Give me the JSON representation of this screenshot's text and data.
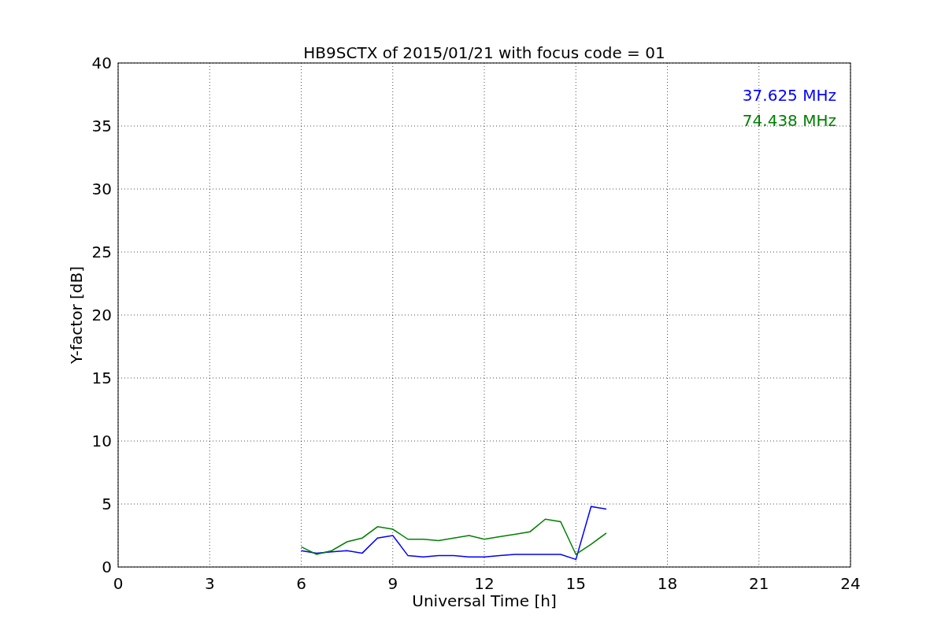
{
  "chart_data": {
    "type": "line",
    "title": "HB9SCTX of 2015/01/21 with focus code = 01",
    "xlabel": "Universal Time [h]",
    "ylabel": "Y-factor [dB]",
    "x": [
      6,
      6.5,
      7,
      7.5,
      8,
      8.5,
      9,
      9.5,
      10,
      10.5,
      11,
      11.5,
      12,
      12.5,
      13,
      13.5,
      14,
      14.5,
      15,
      15.5,
      16
    ],
    "series": [
      {
        "name": "37.625 MHz",
        "color": "#0000ff",
        "values": [
          1.3,
          1.1,
          1.2,
          1.3,
          1.1,
          2.3,
          2.5,
          0.9,
          0.8,
          0.9,
          0.9,
          0.8,
          0.8,
          0.9,
          1.0,
          1.0,
          1.0,
          1.0,
          0.6,
          4.8,
          4.6
        ]
      },
      {
        "name": "74.438 MHz",
        "color": "#008000",
        "values": [
          1.6,
          1.0,
          1.3,
          2.0,
          2.3,
          3.2,
          3.0,
          2.2,
          2.2,
          2.1,
          2.3,
          2.5,
          2.2,
          2.4,
          2.6,
          2.8,
          3.8,
          3.6,
          1.0,
          1.8,
          2.7
        ]
      }
    ],
    "grid": true,
    "xlim": [
      0,
      24
    ],
    "ylim": [
      0,
      40
    ],
    "xticks": [
      0,
      3,
      6,
      9,
      12,
      15,
      18,
      21,
      24
    ],
    "yticks": [
      0,
      5,
      10,
      15,
      20,
      25,
      30,
      35,
      40
    ]
  }
}
